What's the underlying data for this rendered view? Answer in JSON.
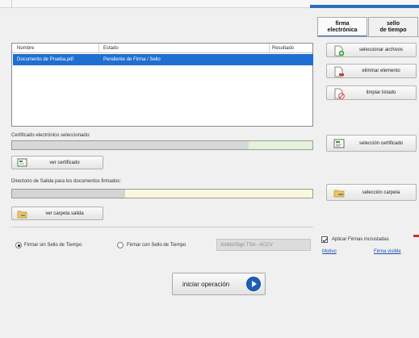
{
  "tabs": [
    {
      "label_line1": "firma",
      "label_line2": "electrónica"
    },
    {
      "label_line1": "sello",
      "label_line2": "de tiempo"
    }
  ],
  "document_list": {
    "columns": [
      "Nombre",
      "Estado",
      "Resultado"
    ],
    "rows": [
      {
        "nombre": "Documento de Prueba.pdf",
        "estado": "Pendiente de Firma / Sello",
        "resultado": ""
      }
    ]
  },
  "side_buttons": {
    "add_files": "seleccionar archivos",
    "remove_item": "eliminar elemento",
    "clear_list": "limpiar listado",
    "select_certificate": "selección certificado",
    "select_folder": "selección carpeta"
  },
  "certificate": {
    "label": "Certificado electrónico seleccionado:",
    "view_button": "ver certificado",
    "fill_color": "#e3f2d8"
  },
  "output_dir": {
    "label": "Directorio de Salida para los documentos firmados:",
    "view_button": "ver carpeta salida",
    "fill_color": "#fbf7dc"
  },
  "options": {
    "radio_no_timestamp": "Firmar sin Sello de Tiempo",
    "radio_with_timestamp": "Firmar con Sello de Tiempo",
    "tsa_dropdown_value": "Xolido/Sign TSA - ACCV",
    "embed_signatures": "Aplicar Firmas incrustadas",
    "link_reason": "Motivo",
    "link_visible_signature": "Firma visible"
  },
  "start_button": "iniciar operación",
  "colors": {
    "selection_blue": "#1f6fd0",
    "accent_blue": "#2a6ebd"
  }
}
